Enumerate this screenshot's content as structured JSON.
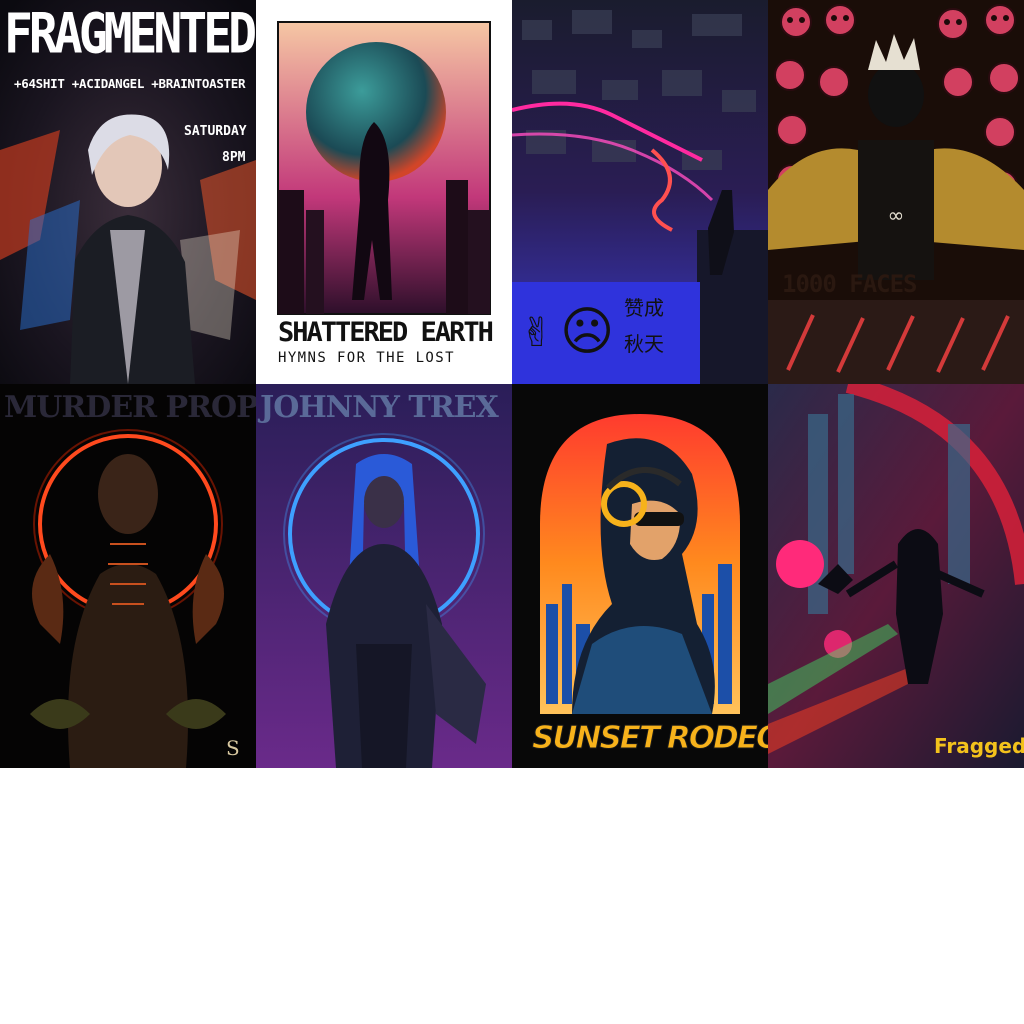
{
  "posters": [
    {
      "title": "FRAGMENTED",
      "lineup": "+64SHIT +ACIDANGEL +BRAINTOASTER",
      "day": "SATURDAY",
      "time": "8PM"
    },
    {
      "title": "SHATTERED EARTH",
      "subtitle": "HYMNS FOR THE LOST"
    },
    {
      "symbols": [
        "peace-hand",
        "sad-face"
      ],
      "text_line1": "赞成",
      "text_line2": "秋天"
    },
    {
      "text": "1000 FACES"
    },
    {
      "band_name": "MURDER PROPHET",
      "signature": "S"
    },
    {
      "band_name": "JOHNNY TREX"
    },
    {
      "title": "SUNSET RODEO"
    },
    {
      "title": "Fragged"
    }
  ],
  "colors": {
    "page_background": "#ffffff",
    "sunset_rodeo_title": "#f7b21b",
    "fragged_title": "#f3c21c"
  }
}
